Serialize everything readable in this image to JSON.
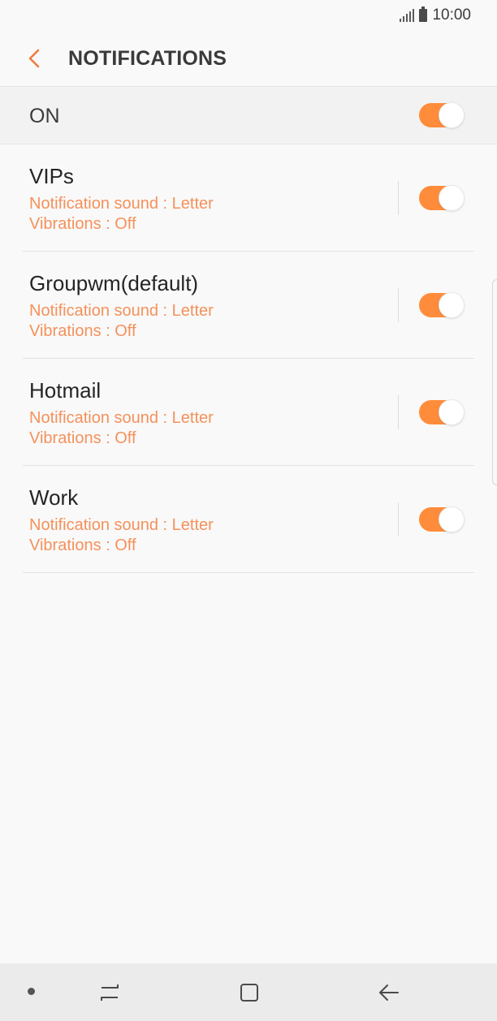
{
  "status_bar": {
    "time": "10:00",
    "icons": [
      "signal-icon",
      "battery-icon"
    ]
  },
  "header": {
    "title": "NOTIFICATIONS",
    "back_icon": "chevron-left-icon"
  },
  "master_switch": {
    "label": "ON",
    "on": true
  },
  "accounts": [
    {
      "name": "VIPs",
      "sound": "Notification sound : Letter",
      "vibrations": "Vibrations : Off",
      "on": true
    },
    {
      "name": "Groupwm(default)",
      "sound": "Notification sound : Letter",
      "vibrations": "Vibrations : Off",
      "on": true
    },
    {
      "name": "Hotmail",
      "sound": "Notification sound : Letter",
      "vibrations": "Vibrations : Off",
      "on": true
    },
    {
      "name": "Work",
      "sound": "Notification sound : Letter",
      "vibrations": "Vibrations : Off",
      "on": true
    }
  ],
  "nav_bar": {
    "icons": [
      "dot-icon",
      "recents-icon",
      "home-icon",
      "back-arrow-icon"
    ]
  },
  "colors": {
    "accent": "#ff8c3a",
    "secondary_text": "#f5915a",
    "background": "#f9f9f9"
  }
}
